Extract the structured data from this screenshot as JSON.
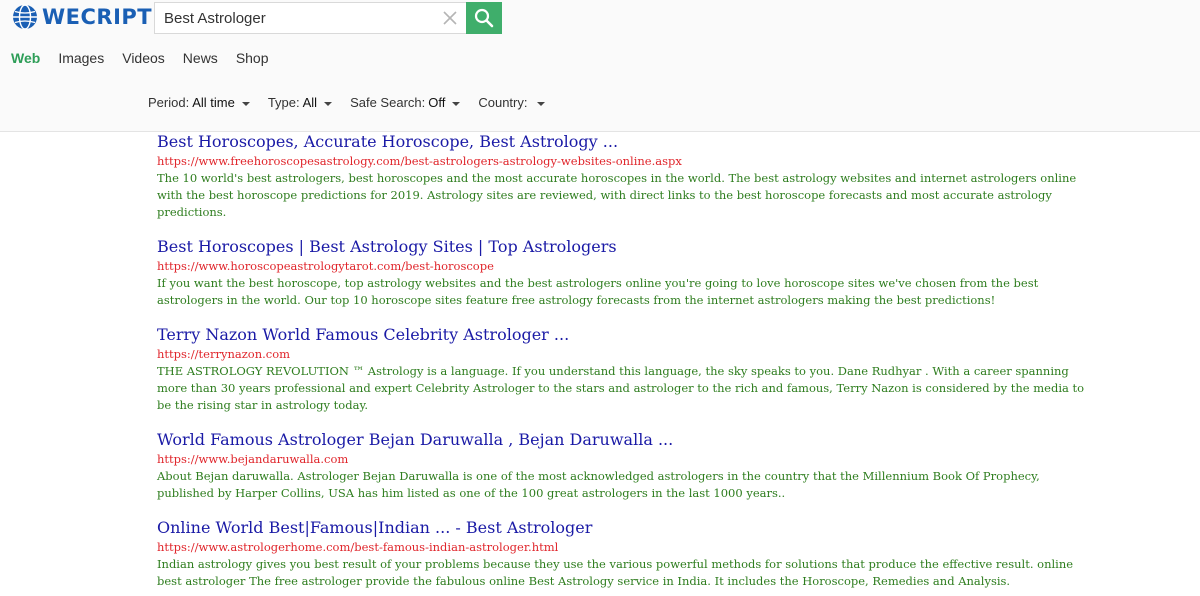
{
  "logo": {
    "text": "WECRIPT"
  },
  "search": {
    "query": "Best Astrologer"
  },
  "tabs": [
    {
      "label": "Web"
    },
    {
      "label": "Images"
    },
    {
      "label": "Videos"
    },
    {
      "label": "News"
    },
    {
      "label": "Shop"
    }
  ],
  "filters": {
    "period": {
      "label": "Period:",
      "value": "All time"
    },
    "type": {
      "label": "Type:",
      "value": "All"
    },
    "safe_search": {
      "label": "Safe Search:",
      "value": "Off"
    },
    "country": {
      "label": "Country:",
      "value": ""
    }
  },
  "results": [
    {
      "title": "Best Horoscopes, Accurate Horoscope, Best Astrology ...",
      "url": "https://www.freehoroscopesastrology.com/best-astrologers-astrology-websites-online.aspx",
      "desc": "The 10 world's best astrologers, best horoscopes and the most accurate horoscopes in the world. The best astrology websites and internet astrologers online with the best horoscope predictions for 2019. Astrology sites are reviewed, with direct links to the best horoscope forecasts and most accurate astrology predictions."
    },
    {
      "title": "Best Horoscopes | Best Astrology Sites | Top Astrologers",
      "url": "https://www.horoscopeastrologytarot.com/best-horoscope",
      "desc": "If you want the best horoscope, top astrology websites and the best astrologers online you're going to love horoscope sites we've chosen from the best astrologers in the world. Our top 10 horoscope sites feature free astrology forecasts from the internet astrologers making the best predictions!"
    },
    {
      "title": "Terry Nazon World Famous Celebrity Astrologer ...",
      "url": "https://terrynazon.com",
      "desc": "THE ASTROLOGY REVOLUTION ™ Astrology is a language. If you understand this language, the sky speaks to you. Dane Rudhyar . With a career spanning more than 30 years professional and expert Celebrity Astrologer to the stars and astrologer to the rich and famous, Terry Nazon is considered by the media to be the rising star in astrology today."
    },
    {
      "title": "World Famous Astrologer Bejan Daruwalla , Bejan Daruwalla ...",
      "url": "https://www.bejandaruwalla.com",
      "desc": "About Bejan daruwalla. Astrologer Bejan Daruwalla is one of the most acknowledged astrologers in the country that the Millennium Book Of Prophecy, published by Harper Collins, USA has him listed as one of the 100 great astrologers in the last 1000 years.."
    },
    {
      "title": "Online World Best|Famous|Indian ... - Best Astrologer",
      "url": "https://www.astrologerhome.com/best-famous-indian-astrologer.html",
      "desc": "Indian astrology gives you best result of your problems because they use the various powerful methods for solutions that produce the effective result. online best astrologer The free astrologer provide the fabulous online Best Astrology service in India. It includes the Horoscope, Remedies and Analysis."
    }
  ],
  "colors": {
    "accent": "#3fae6b",
    "tab_active": "#2e9e58",
    "title": "#1a1aa6",
    "url": "#e0252b",
    "desc": "#2e7d1e",
    "logo": "#1a5fb4"
  }
}
